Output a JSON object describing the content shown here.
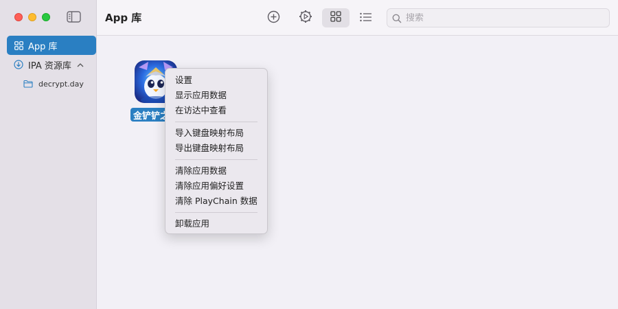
{
  "sidebar": {
    "items": [
      {
        "label": "App 库",
        "icon": "grid-icon",
        "active": true
      },
      {
        "label": "IPA 资源库",
        "icon": "download-circle-icon",
        "active": false
      }
    ],
    "sub_items": [
      {
        "label": "decrypt.day",
        "icon": "folder-icon"
      }
    ]
  },
  "toolbar": {
    "title": "App 库",
    "search_placeholder": "搜索"
  },
  "apps": [
    {
      "label": "金铲铲之战",
      "icon": "game-app-icon"
    }
  ],
  "context_menu": {
    "groups": [
      [
        "设置",
        "显示应用数据",
        "在访达中查看"
      ],
      [
        "导入键盘映射布局",
        "导出键盘映射布局"
      ],
      [
        "清除应用数据",
        "清除应用偏好设置",
        "清除 PlayChain 数据"
      ],
      [
        "卸载应用"
      ]
    ]
  },
  "colors": {
    "accent": "#2a7fc2",
    "sidebar_bg": "#e4e0e7",
    "content_bg": "#f2f0f6"
  }
}
